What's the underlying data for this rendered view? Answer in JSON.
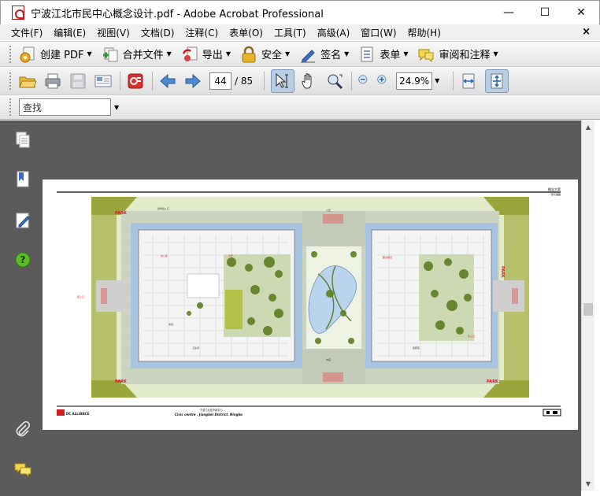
{
  "window": {
    "title": "宁波江北市民中心概念设计.pdf - Adobe Acrobat Professional",
    "minimize": "—",
    "maximize": "☐",
    "close": "✕"
  },
  "menu": {
    "items": [
      "文件(F)",
      "编辑(E)",
      "视图(V)",
      "文档(D)",
      "注释(C)",
      "表单(O)",
      "工具(T)",
      "高级(A)",
      "窗口(W)",
      "帮助(H)"
    ],
    "close_doc": "×"
  },
  "toolbar": {
    "create_pdf": "创建 PDF",
    "combine": "合并文件",
    "export": "导出",
    "secure": "安全",
    "sign": "签名",
    "forms": "表单",
    "review": "审阅和注释"
  },
  "navigation": {
    "current_page": "44",
    "total_pages": "/ 85",
    "zoom": "24.9%"
  },
  "find": {
    "placeholder": "查找"
  },
  "document": {
    "page_header_right": "概念方案",
    "page_header_sub": "一层平面图",
    "park_label": "PARK",
    "logo_text": "DC ALLIANCE",
    "footer_cn": "宁波江北区市民中心",
    "footer_en": "Civic centre . Jiangbei District. Ningbo",
    "labels": {
      "entry": "建筑出入口",
      "bus": "公交",
      "east_entry": "东入口",
      "west_entry": "西入口",
      "office": "办公区",
      "hall": "大厅",
      "shop": "商店",
      "wc": "卫生间",
      "library": "图书阅览",
      "dock": "装卸区",
      "court": "中庭"
    }
  }
}
